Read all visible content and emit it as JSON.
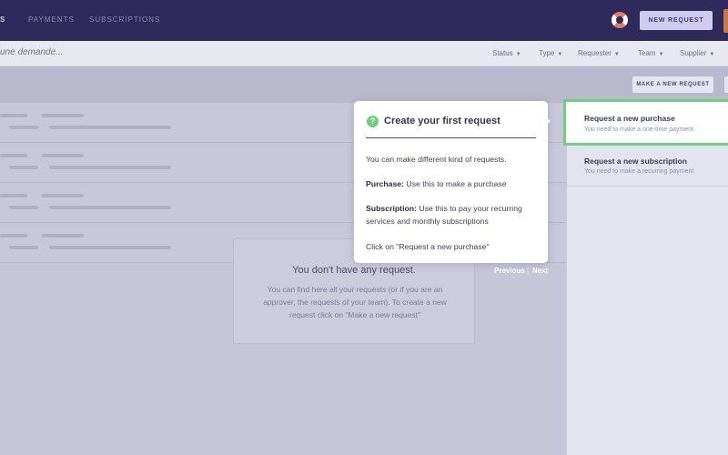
{
  "topnav": {
    "items": [
      {
        "label": "S"
      },
      {
        "label": "PAYMENTS"
      },
      {
        "label": "SUBSCRIPTIONS"
      }
    ],
    "new_request_label": "NEW REQUEST",
    "help_icon": "lifebuoy-icon"
  },
  "filterbar": {
    "search_placeholder": "une demande...",
    "filters": [
      {
        "label": "Status"
      },
      {
        "label": "Type"
      },
      {
        "label": "Requester"
      },
      {
        "label": "Team"
      },
      {
        "label": "Supplier"
      }
    ],
    "caret": "▼"
  },
  "content": {
    "make_request_label": "MAKE A NEW REQUEST",
    "empty_state": {
      "title": "You don't have any request.",
      "description": "You can find here all your requests (or if you are an approver, the requests of your team). To create a new request click on \"Make a new request\""
    }
  },
  "request_options": [
    {
      "title": "Request a new purchase",
      "description": "You need to make a one-time payment"
    },
    {
      "title": "Request a new subscription",
      "description": "You need to make a recurring payment"
    }
  ],
  "tour": {
    "icon": "?",
    "title": "Create your first request",
    "intro": "You can make different kind of requests.",
    "purchase_label": "Purchase:",
    "purchase_text": " Use this to make a purchase",
    "subscription_label": "Subscription:",
    "subscription_text": " Use this to pay your recurring services and monthly subscriptions",
    "cta": "Click on \"Request a new purchase\"",
    "previous_label": "Previous",
    "separator": "|",
    "next_label": "Next"
  },
  "colors": {
    "nav_bg": "#2e2a5c",
    "accent_green": "#6fcf7c",
    "primary": "#3d3890"
  }
}
